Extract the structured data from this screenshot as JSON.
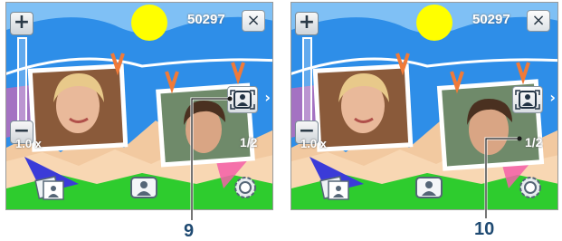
{
  "panels": [
    {
      "counter": "50297",
      "zoom": {
        "in_label": "+",
        "out_label": "−",
        "level": "1.0 x"
      },
      "close_label": "×",
      "page": "1/2",
      "next": "›"
    },
    {
      "counter": "50297",
      "zoom": {
        "in_label": "+",
        "out_label": "−",
        "level": "1.0 x"
      },
      "close_label": "×",
      "page": "1/2",
      "next": "›"
    }
  ],
  "callouts": {
    "left": "9",
    "right": "10"
  },
  "icons": [
    "zoom-in-icon",
    "zoom-out-icon",
    "close-icon",
    "photo-frame-icon",
    "slideshow-icon",
    "settings-gear-icon",
    "fit-screen-icon"
  ],
  "colors": {
    "sky": "#2e8ee8",
    "sun": "#ffff00",
    "grass": "#2ecc2e",
    "hills": "#f2c9a0",
    "ground": "#3b3bd8",
    "pink": "#f45fa8",
    "accent": "#1f4a72"
  }
}
